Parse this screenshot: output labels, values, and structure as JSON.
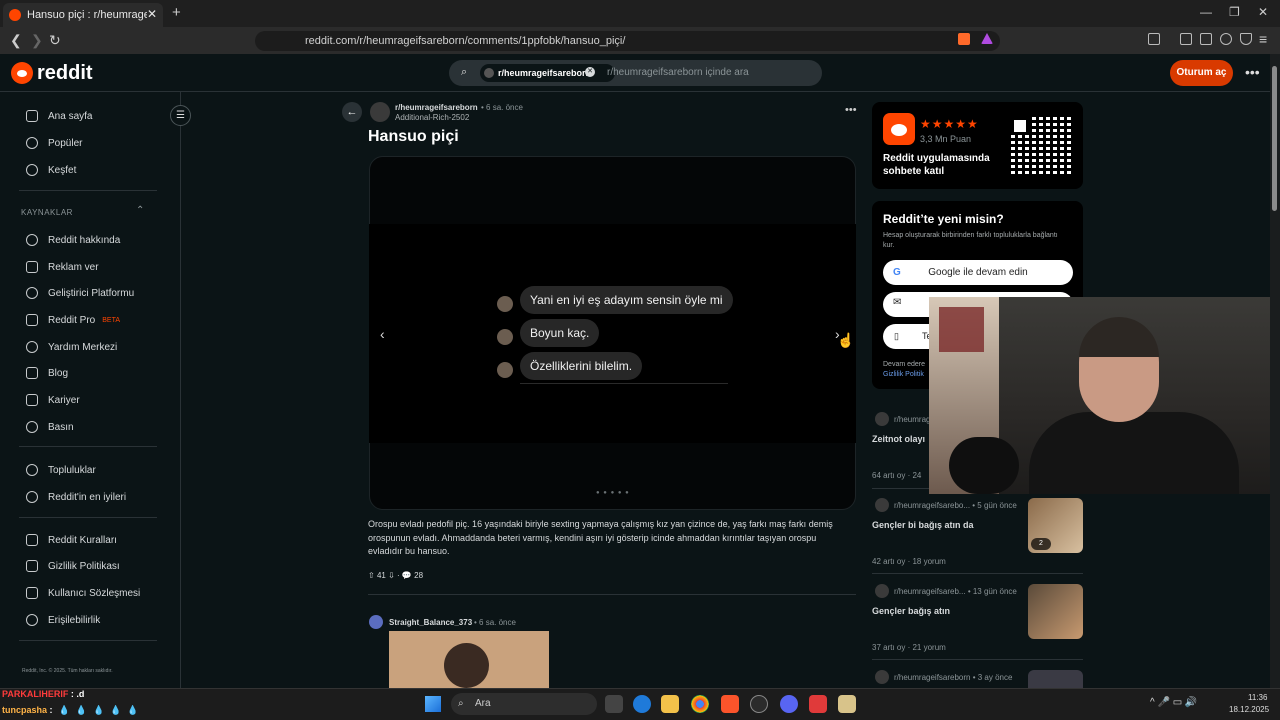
{
  "browser": {
    "tab_title": "Hansuo piçi : r/heumrageifsareb",
    "tab_close": "✕",
    "new_tab": "+",
    "url": "reddit.com/r/heumrageifsareborn/comments/1ppfobk/hansuo_piçi/",
    "window_controls": [
      "—",
      "❐",
      "✕"
    ]
  },
  "header": {
    "logo_text": "reddit",
    "search_chip": "r/heumrageifsareborn",
    "search_placeholder": "r/heumrageifsareborn içinde ara",
    "login_label": "Oturum aç",
    "more_label": "•••"
  },
  "sidebar": {
    "toggle_icon": "☰",
    "main_items": [
      {
        "label": "Ana sayfa",
        "icon": "home-icon"
      },
      {
        "label": "Popüler",
        "icon": "popular-icon"
      },
      {
        "label": "Keşfet",
        "icon": "explore-icon"
      }
    ],
    "section_title": "KAYNAKLAR",
    "resource_items": [
      {
        "label": "Reddit hakkında",
        "icon": "reddit-icon"
      },
      {
        "label": "Reklam ver",
        "icon": "megaphone-icon"
      },
      {
        "label": "Geliştirici Platformu",
        "icon": "dev-icon"
      },
      {
        "label": "Reddit Pro",
        "icon": "pro-icon",
        "badge": "BETA"
      },
      {
        "label": "Yardım Merkezi",
        "icon": "help-icon"
      },
      {
        "label": "Blog",
        "icon": "blog-icon"
      },
      {
        "label": "Kariyer",
        "icon": "career-icon"
      },
      {
        "label": "Basın",
        "icon": "press-icon"
      }
    ],
    "community_items": [
      {
        "label": "Topluluklar",
        "icon": "communities-icon"
      },
      {
        "label": "Reddit'in en iyileri",
        "icon": "best-icon"
      }
    ],
    "policy_items": [
      {
        "label": "Reddit Kuralları",
        "icon": "rules-icon"
      },
      {
        "label": "Gizlilik Politikası",
        "icon": "privacy-icon"
      },
      {
        "label": "Kullanıcı Sözleşmesi",
        "icon": "agreement-icon"
      },
      {
        "label": "Erişilebilirlik",
        "icon": "accessibility-icon"
      }
    ],
    "footer": "Reddit, Inc. © 2025. Tüm hakları saklıdır."
  },
  "post": {
    "subreddit": "r/heumrageifsareborn",
    "time": "• 6 sa. önce",
    "author": "Additional-Rich-2502",
    "menu": "•••",
    "title": "Hansuo piçi",
    "messages": [
      "Yani en iyi eş adayım sensin öyle mi",
      "Boyun kaç.",
      "Özelliklerini bilelim."
    ],
    "carousel_prev": "‹",
    "carousel_next": "›",
    "carousel_dots": "● ● ● ● ●",
    "carousel_active": 3,
    "carousel_total": 5,
    "body": "Orospu evladı pedofil piç. 16 yaşındaki biriyle sexting yapmaya çalışmış kız yan çizince de, yaş farkı maş farkı demiş orospunun evladı. Ahmaddanda beteri varmış, kendini aşırı iyi gösterip icinde ahmaddan kırıntılar taşıyan orospu evladıdır bu hansuo.",
    "upvotes": "41",
    "comments": "28"
  },
  "comment": {
    "user": "Straight_Balance_373",
    "time": "• 6 sa. önce"
  },
  "right": {
    "app_rating": "3,3 Mn Puan",
    "app_stars": "★★★★★",
    "app_text": "Reddit uygulamasında sohbete katıl",
    "new_title": "Reddit’te yeni misin?",
    "new_desc": "Hesap oluşturarak birbirinden farklı topluluklarla bağlantı kur.",
    "google_btn": "Google ile devam edin",
    "phone_btn": "Te",
    "terms_line": "Devam edere",
    "terms_link": "Gizlilik Politik",
    "related": [
      {
        "sub": "r/heumrag",
        "title": "Zeitnot olayı",
        "stats": "64 artı oy  ·  24"
      },
      {
        "sub": "r/heumrageifsarebo...  •  5 gün önce",
        "title": "Gençler bi bağış atın da",
        "stats": "42 artı oy  ·  18 yorum",
        "thumb_badge": "2"
      },
      {
        "sub": "r/heumrageifsareb...  •  13 gün önce",
        "title": "Gençler bağış atın",
        "stats": "37 artı oy  ·  21 yorum"
      },
      {
        "sub": "r/heumrageifsareborn  •  3 ay önce",
        "title": "",
        "stats": ""
      }
    ]
  },
  "taskbar": {
    "search_label": "Ara",
    "time": "11:36",
    "date": "18.12.2025",
    "tray": "^  🎤  ▭  🔊"
  },
  "chat": {
    "line1_name": "PARKALIHERIF",
    "line1_text": ": .d",
    "line2_name": "tuncpasha",
    "line2_text": ":",
    "line2_drops": "💧💧💧💧💧"
  },
  "colors": {
    "accent": "#ff4500",
    "login_bg": "#d93a00",
    "background": "#0b1416"
  }
}
